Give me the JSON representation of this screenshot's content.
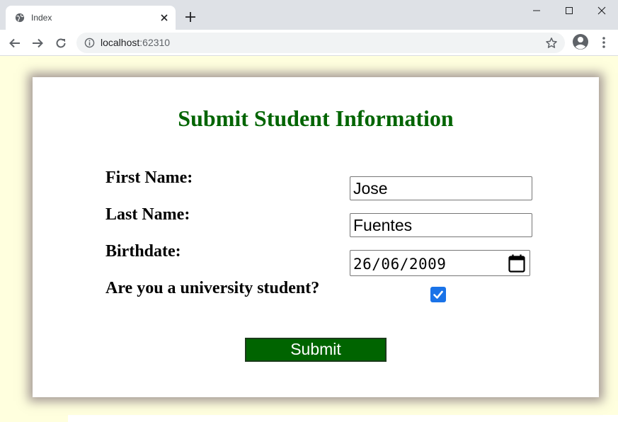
{
  "browser": {
    "tab": {
      "title": "Index",
      "favicon": "globe-icon"
    },
    "url": {
      "host": "localhost",
      "port": ":62310"
    },
    "icons": {
      "back": "arrow-left-icon",
      "forward": "arrow-right-icon",
      "reload": "reload-icon",
      "site_info": "info-icon",
      "bookmark": "star-icon",
      "profile": "profile-icon",
      "menu": "menu-icon"
    }
  },
  "page": {
    "background": "#ffffde",
    "title": "Submit Student Information",
    "title_color": "#006400",
    "fields": {
      "first_name": {
        "label": "First Name:",
        "value": "Jose"
      },
      "last_name": {
        "label": "Last Name:",
        "value": "Fuentes"
      },
      "birthdate": {
        "label": "Birthdate:",
        "value": "26/06/2009"
      },
      "university": {
        "label": "Are you a university student?",
        "checked": true
      }
    },
    "submit_label": "Submit",
    "submit_color": "#006400",
    "checkbox_color": "#1a73e8"
  }
}
